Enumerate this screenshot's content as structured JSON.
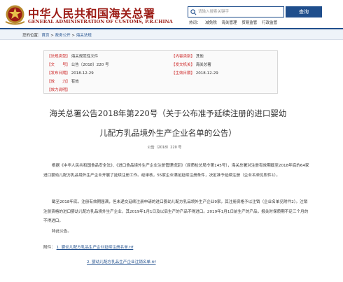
{
  "header": {
    "site_name_cn": "中华人民共和国海关总署",
    "site_name_en": "GENERAL ADMINISTRATION OF CUSTOMS, P.R.CHINA",
    "search_placeholder": "请输入搜索关键字",
    "search_button": "查询",
    "hotwords_label": "热词：",
    "hotwords": [
      "减免税",
      "海关管理",
      "贸易监管",
      "行政监管"
    ]
  },
  "breadcrumb": {
    "prefix": "您的位置：",
    "items": [
      "首页",
      "政务公开",
      "海关法规"
    ],
    "separator": " > "
  },
  "info": {
    "law_type_label": "【法规类型】",
    "law_type_value": "海关规范性文件",
    "content_category_label": "【内容类别】",
    "content_category_value": "其他",
    "doc_number_label": "【文　　号】",
    "doc_number_value": "公告〔2018〕220 号",
    "issuing_org_label": "【发文机关】",
    "issuing_org_value": "海关总署",
    "issue_date_label": "【发布日期】",
    "issue_date_value": "2018-12-29",
    "effective_date_label": "【生效日期】",
    "effective_date_value": "2018-12-29",
    "validity_label": "【效　　力】",
    "validity_value": "有效",
    "validity_note_label": "【效力说明】",
    "validity_note_value": ""
  },
  "article": {
    "title_line1": "海关总署公告2018年第220号（关于公布准予延续注册的进口婴幼",
    "title_line2": "儿配方乳品境外生产企业名单的公告）",
    "doc_no": "公告〔2018〕220 号",
    "para1": "根据《中华人民共和国食品安全法》、《进口食品境外生产企业注册管理规定》（原质检总局令第145号），海关总署对注册有效期截至2018年底的64家进口婴幼儿配方乳品境外生产企业开展了延续注册工作。经审核，55家企业满足延续注册条件，决定准予延续注册（企业名单见附件1）。",
    "para2": "截至2018年底，注册有效期届满，但未递交延续注册申请的进口婴幼儿配方乳品境外生产企业9家，其注册资格予以注销（企业名单见附件2）。注销注册资格的进口婴幼儿配方乳品境外生产企业，其2019年1月1日及以后生产的产品不得进口。2019年1月1日前生产的产品，报关时保质期不足三个月的不得进口。",
    "para3": "特此公告。",
    "attachments_label": "附件：",
    "attachment1": "1. 婴幼儿配方乳品生产企业延续注册名单.tif",
    "attachment2": "2. 婴幼儿配方乳品生产企业注销名单.tif"
  }
}
